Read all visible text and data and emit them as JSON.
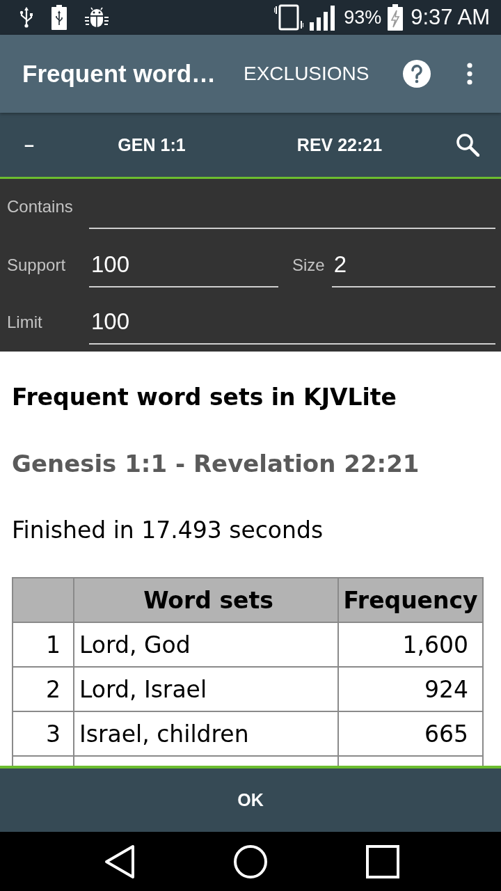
{
  "status_bar": {
    "battery": "93%",
    "time": "9:37 AM"
  },
  "app_bar": {
    "title": "Frequent word…",
    "action": "EXCLUSIONS"
  },
  "range_bar": {
    "collapse": "–",
    "start": "GEN 1:1",
    "end": "REV 22:21"
  },
  "form": {
    "rows": [
      [
        {
          "label": "Contains"
        }
      ],
      [
        {
          "label": "Support",
          "value": "100"
        },
        {
          "label": "Size",
          "value": "2"
        }
      ],
      [
        {
          "label": "Limit",
          "value": "100"
        }
      ]
    ]
  },
  "report": {
    "title": "Frequent word sets in KJVLite",
    "range": "Genesis 1:1 - Revelation 22:21",
    "timing": "Finished in 17.493 seconds"
  },
  "table": {
    "columns": [
      "Word sets",
      "Frequency"
    ],
    "rows": [
      {
        "index": "1",
        "word_set": "Lord, God",
        "frequency": "1,600"
      },
      {
        "index": "2",
        "word_set": "Lord, Israel",
        "frequency": "924"
      },
      {
        "index": "3",
        "word_set": "Israel, children",
        "frequency": "665"
      }
    ]
  },
  "footer": {
    "button": "OK"
  }
}
